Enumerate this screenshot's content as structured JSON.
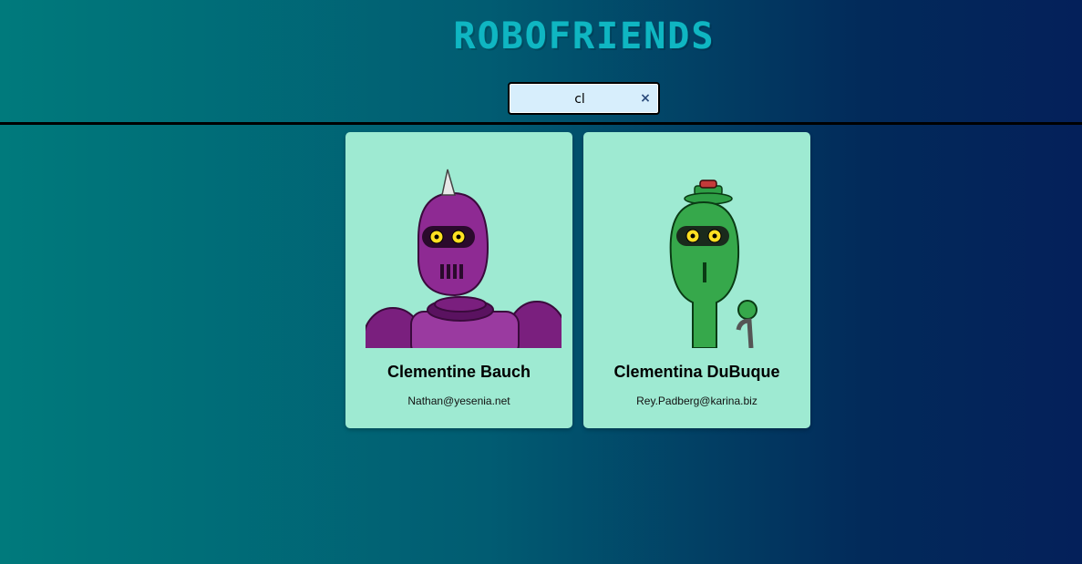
{
  "header": {
    "app_title": "ROBOFRIENDS"
  },
  "search": {
    "value": "cl",
    "clear_symbol": "×"
  },
  "robots": [
    {
      "name": "Clementine Bauch",
      "email": "Nathan@yesenia.net",
      "avatar_color": "#8a2a8f"
    },
    {
      "name": "Clementina DuBuque",
      "email": "Rey.Padberg@karina.biz",
      "avatar_color": "#2e9e45"
    }
  ],
  "colors": {
    "card_background": "#9eead2",
    "title_color": "#0fb6c2",
    "search_background": "#d7eefc"
  }
}
